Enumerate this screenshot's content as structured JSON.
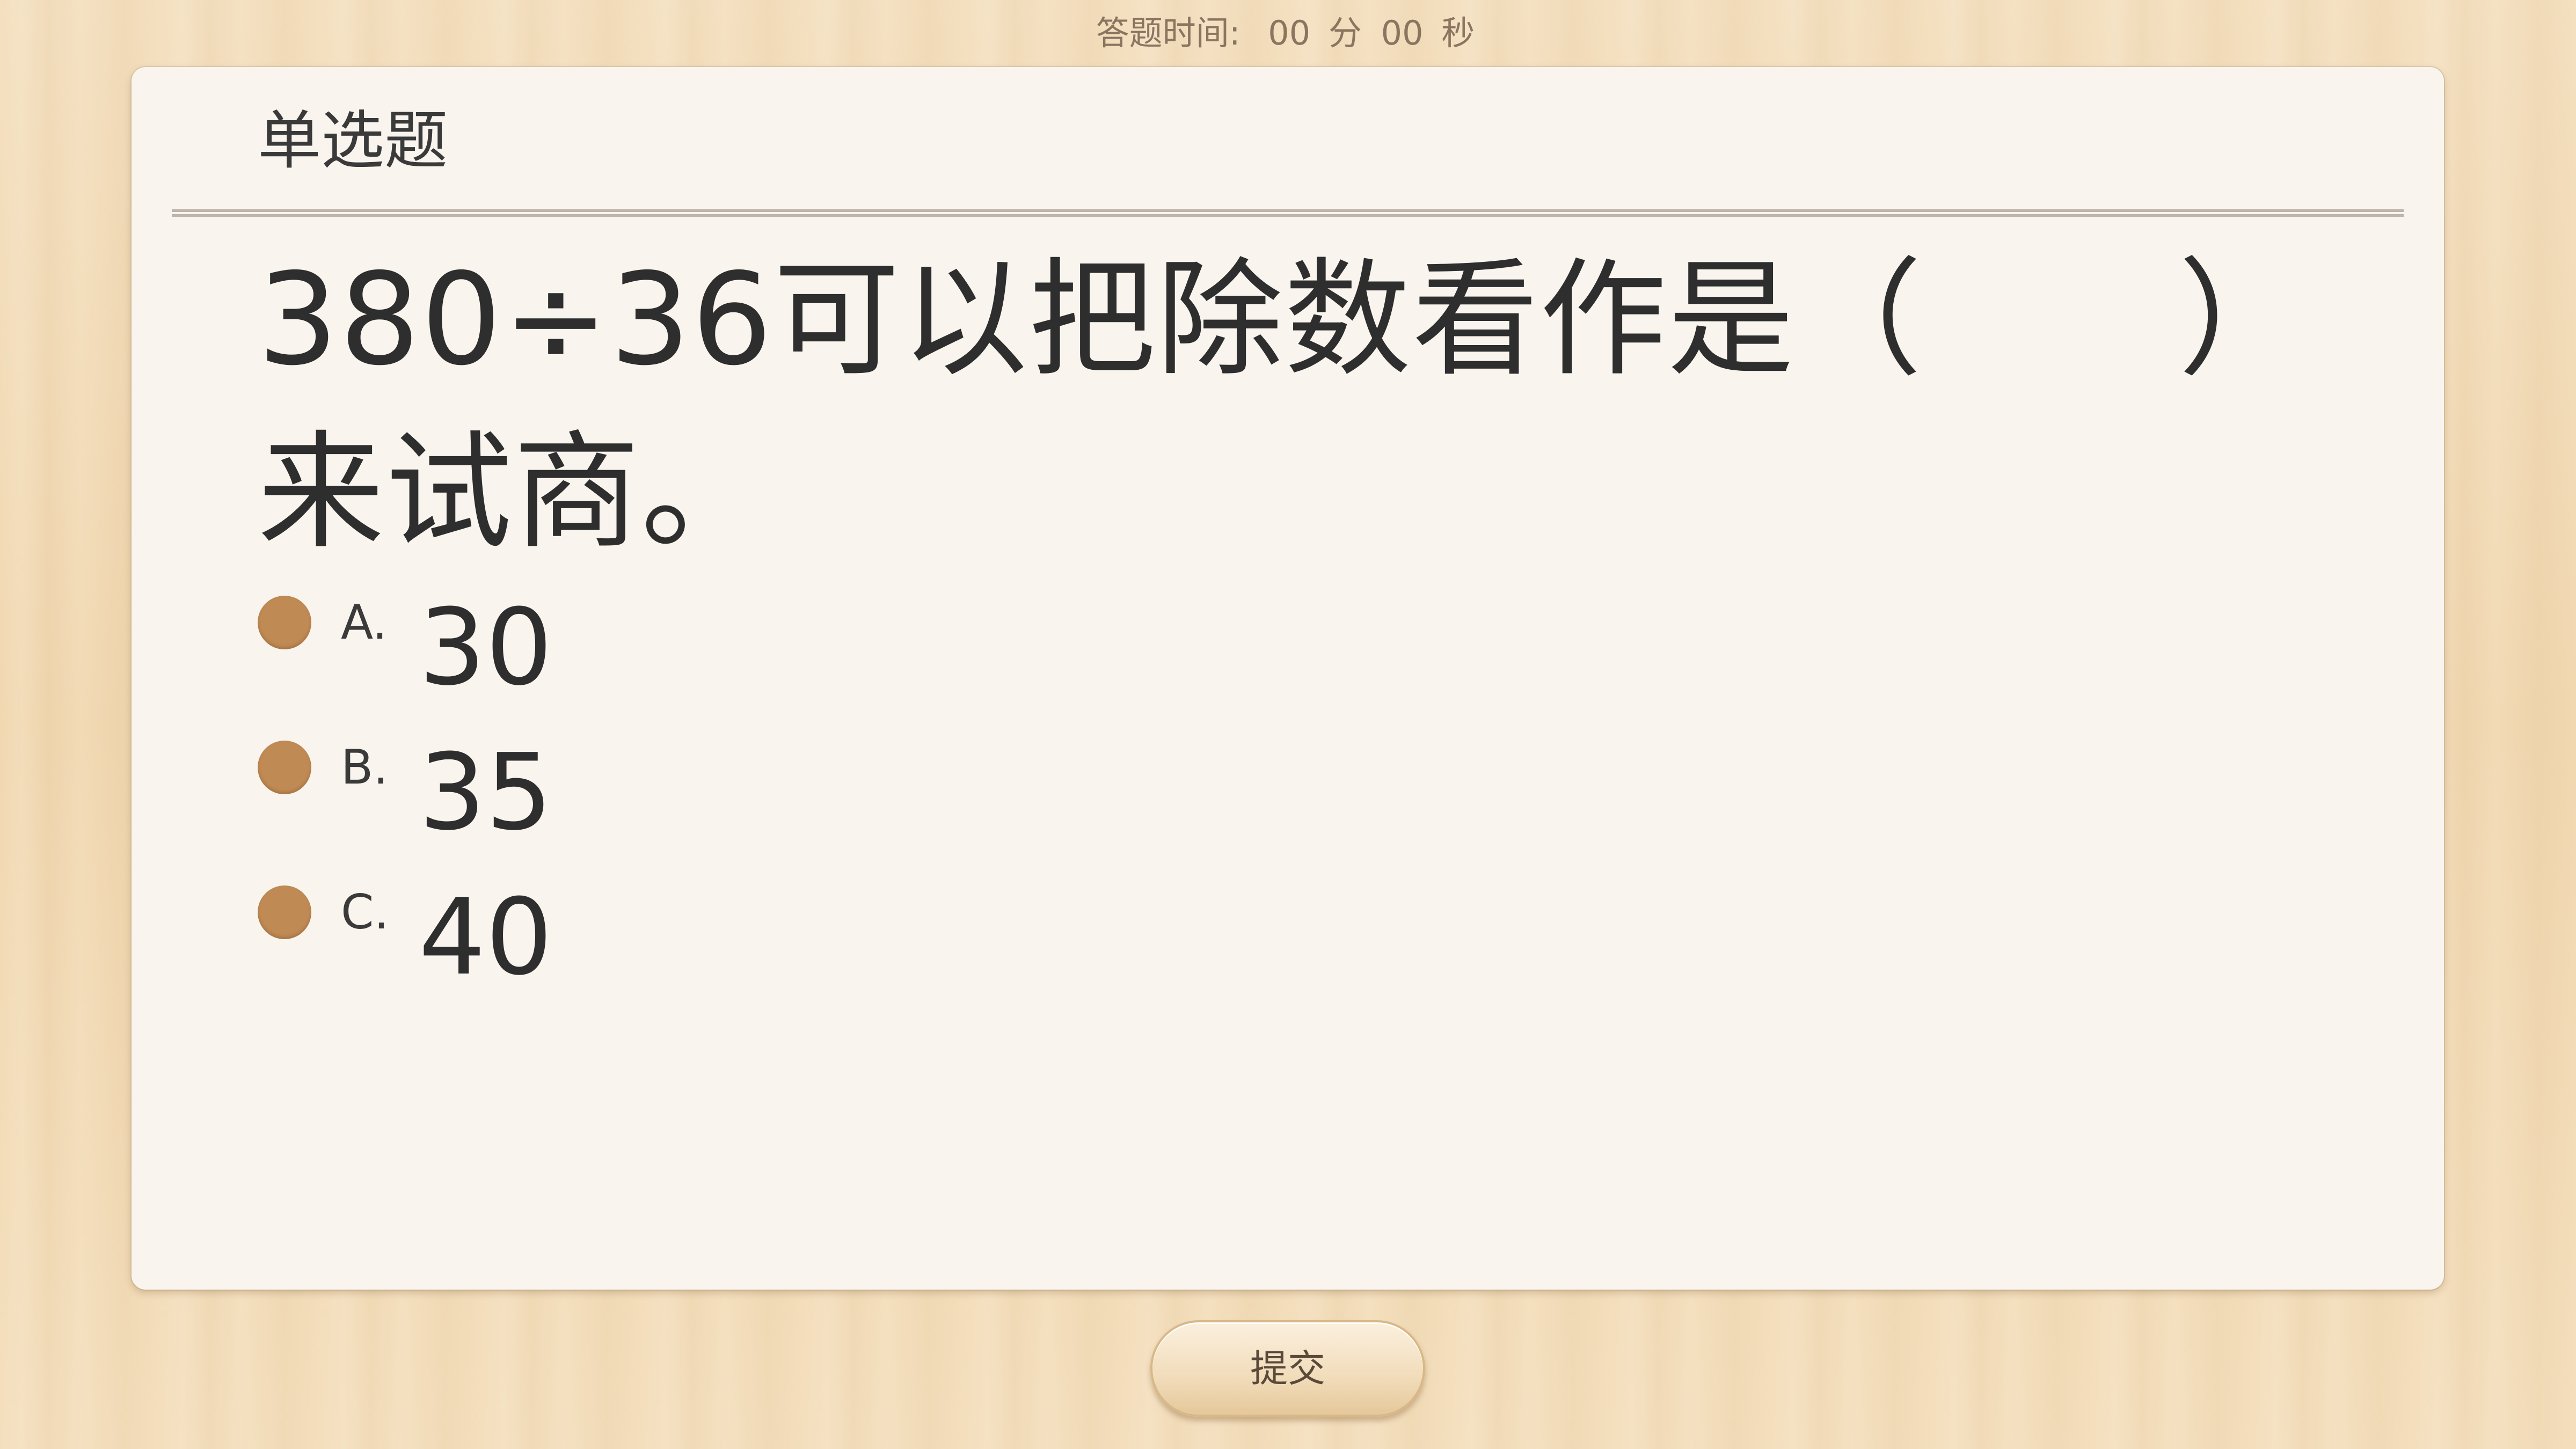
{
  "timer": {
    "label": "答题时间:",
    "minutes": "00",
    "minutes_unit": "分",
    "seconds": "00",
    "seconds_unit": "秒"
  },
  "question": {
    "type": "单选题",
    "text": "380÷36可以把除数看作是（　　）来试商。",
    "options": [
      {
        "letter": "A.",
        "value": "30"
      },
      {
        "letter": "B.",
        "value": "35"
      },
      {
        "letter": "C.",
        "value": "40"
      }
    ]
  },
  "submit_label": "提交",
  "colors": {
    "radio": "#c08a55",
    "card_background": "#f9f5ee",
    "page_background": "#f3ddba"
  }
}
